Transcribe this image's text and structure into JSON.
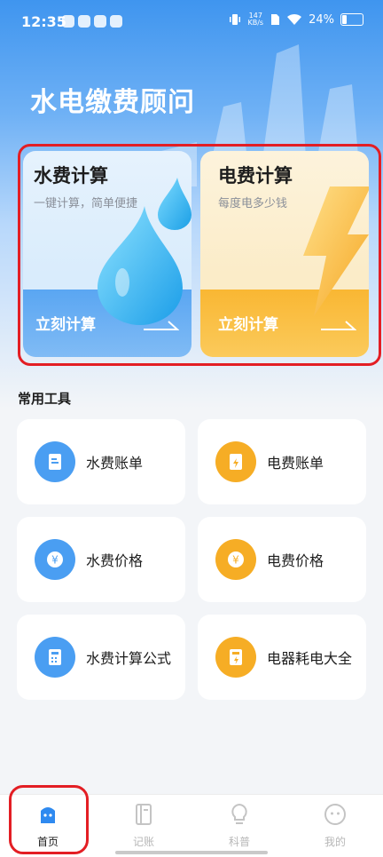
{
  "status_bar": {
    "time": "12:35",
    "netspeed_value": "147",
    "netspeed_unit": "KB/s",
    "battery": "24%"
  },
  "app_title": "水电缴费顾问",
  "cards": {
    "water": {
      "title": "水费计算",
      "subtitle": "一键计算，简单便捷",
      "button": "立刻计算",
      "color": "#5aa6f2"
    },
    "electric": {
      "title": "电费计算",
      "subtitle": "每度电多少钱",
      "button": "立刻计算",
      "color": "#f9b733"
    }
  },
  "tools_section": {
    "title": "常用工具",
    "items": [
      {
        "label": "水费账单",
        "icon": "water-bill-icon",
        "color": "#4a9ef2"
      },
      {
        "label": "电费账单",
        "icon": "electric-bill-icon",
        "color": "#f6ad25"
      },
      {
        "label": "水费价格",
        "icon": "water-price-icon",
        "color": "#4a9ef2"
      },
      {
        "label": "电费价格",
        "icon": "electric-price-icon",
        "color": "#f6ad25"
      },
      {
        "label": "水费计算公式",
        "icon": "water-formula-icon",
        "color": "#4a9ef2"
      },
      {
        "label": "电器耗电大全",
        "icon": "appliance-power-icon",
        "color": "#f6ad25"
      }
    ]
  },
  "tabbar": {
    "items": [
      {
        "label": "首页",
        "icon": "home-icon",
        "active": true
      },
      {
        "label": "记账",
        "icon": "notebook-icon",
        "active": false
      },
      {
        "label": "科普",
        "icon": "lightbulb-icon",
        "active": false
      },
      {
        "label": "我的",
        "icon": "profile-icon",
        "active": false
      }
    ]
  },
  "highlight_color": "#e31e24"
}
